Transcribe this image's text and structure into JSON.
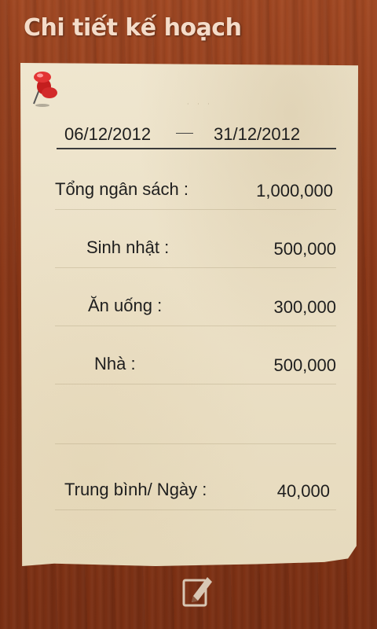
{
  "header": {
    "title": "Chi tiết kế hoạch"
  },
  "plan": {
    "start_date": "06/12/2012",
    "end_date": "31/12/2012",
    "items": [
      {
        "label": "Tổng ngân sách :",
        "value": "1,000,000"
      },
      {
        "label": "Sinh nhật :",
        "value": "500,000"
      },
      {
        "label": "Ăn uống :",
        "value": "300,000"
      },
      {
        "label": "Nhà :",
        "value": "500,000"
      }
    ],
    "average": {
      "label": "Trung bình/ Ngày :",
      "value": "40,000"
    }
  },
  "icons": {
    "pin": "pushpin-icon",
    "edit": "edit-note-icon"
  },
  "colors": {
    "wood": "#8b3818",
    "paper": "#ebe0c6",
    "title": "#f4dcc9",
    "pin": "#d42a2a"
  }
}
